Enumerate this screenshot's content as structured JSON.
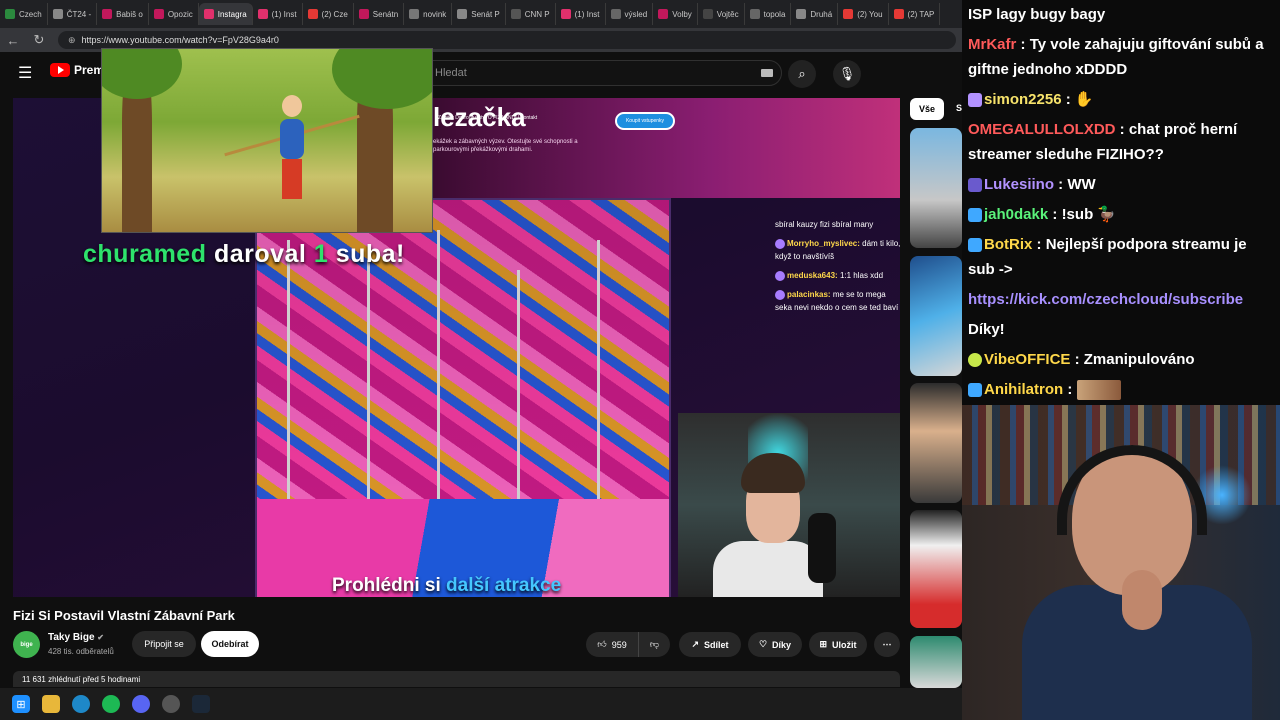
{
  "browser": {
    "tabs": [
      {
        "label": "Czech",
        "color": "#2b8a3e"
      },
      {
        "label": "ČT24 -",
        "color": "#888888"
      },
      {
        "label": "Babiš o",
        "color": "#c2185b"
      },
      {
        "label": "Opozic",
        "color": "#c2185b"
      },
      {
        "label": "Instagra",
        "color": "#e1306c",
        "active": true
      },
      {
        "label": "(1) Inst",
        "color": "#e1306c"
      },
      {
        "label": "(2) Cze",
        "color": "#e53935"
      },
      {
        "label": "Senátn",
        "color": "#c2185b"
      },
      {
        "label": "novink",
        "color": "#777777"
      },
      {
        "label": "Senát P",
        "color": "#888888"
      },
      {
        "label": "CNN P",
        "color": "#555555"
      },
      {
        "label": "(1) Inst",
        "color": "#e1306c"
      },
      {
        "label": "výsled",
        "color": "#666666"
      },
      {
        "label": "Volby",
        "color": "#c2185b"
      },
      {
        "label": "Vojtěc",
        "color": "#444444"
      },
      {
        "label": "topola",
        "color": "#666666"
      },
      {
        "label": "Druhá",
        "color": "#888888"
      },
      {
        "label": "(2) You",
        "color": "#e53935"
      },
      {
        "label": "(2) TAP",
        "color": "#e53935"
      }
    ],
    "url": "https://www.youtube.com/watch?v=FpV28G9a4r0"
  },
  "youtube": {
    "logo": "Premi",
    "search_placeholder": "Hledat",
    "chip_all": "Vše",
    "chip_next": "S"
  },
  "player": {
    "site_title": "lezačka",
    "site_nav": "Zážitky   Dobrodružství   O FIZILANDU   Kontakt",
    "site_desc": "ekážek a zábavných výzev. Otestujte své schopnosti a parkourovými překážkovými drahami.",
    "site_cta": "Koupit vstupenky",
    "alert_user": "churamed",
    "alert_mid": "daroval",
    "alert_count": "1",
    "alert_end": "suba!",
    "chat": [
      {
        "name": "",
        "text": "sbíral kauzy fizi sbíral many"
      },
      {
        "name": "Morryho_myslivec:",
        "text": "dám ti kilo, když to navštívíš"
      },
      {
        "name": "meduska643:",
        "text": "1:1 hlas xdd"
      },
      {
        "name": "palacinkas:",
        "text": "me se to mega seka nevi nekdo o cem se ted baví"
      }
    ],
    "subtitle_a": "Prohlédni si",
    "subtitle_b": "další atrakce"
  },
  "video": {
    "title": "Fizi Si Postavil Vlastní Zábavní Park",
    "channel": "Taky Bige",
    "avatar_text": "bige",
    "subscribers": "428 tis. odběratelů",
    "join": "Připojit se",
    "subscribe": "Odebírat",
    "likes": "959",
    "share": "Sdílet",
    "thanks": "Díky",
    "save": "Uložit",
    "more": "⋯",
    "views_line": "11 631 zhlédnutí  před 5 hodinami"
  },
  "chat_panel": {
    "header": "ISP lagy bugy bagy",
    "messages": [
      {
        "user": "MrKafr",
        "color": "#ff5a5a",
        "text": "Ty vole zahajuju giftování subů a giftne jednoho xDDDD"
      },
      {
        "user": "simon2256",
        "color": "#f7e36b",
        "text": ""
      },
      {
        "user": "OMEGALULLOLXDD",
        "color": "#ff5a5a",
        "text": "chat proč herní streamer sleduhe FIZIHO??"
      },
      {
        "user": "Lukesiino",
        "color": "#b292ff",
        "text": "WW"
      },
      {
        "user": "jah0dakk",
        "color": "#5af27a",
        "text": "!sub"
      },
      {
        "user": "BotRix",
        "color": "#ffd84a",
        "text": "Nejlepší podpora streamu je sub ->"
      },
      {
        "user": "",
        "color": "#a890ff",
        "text": "https://kick.com/czechcloud/subscribe"
      },
      {
        "user": "",
        "color": "#ffffff",
        "text": "Díky!"
      },
      {
        "user": "VibeOFFICE",
        "color": "#ffd84a",
        "text": "Zmanipulováno"
      },
      {
        "user": "Anihilatron",
        "color": "#ffd84a",
        "text": ""
      }
    ]
  }
}
